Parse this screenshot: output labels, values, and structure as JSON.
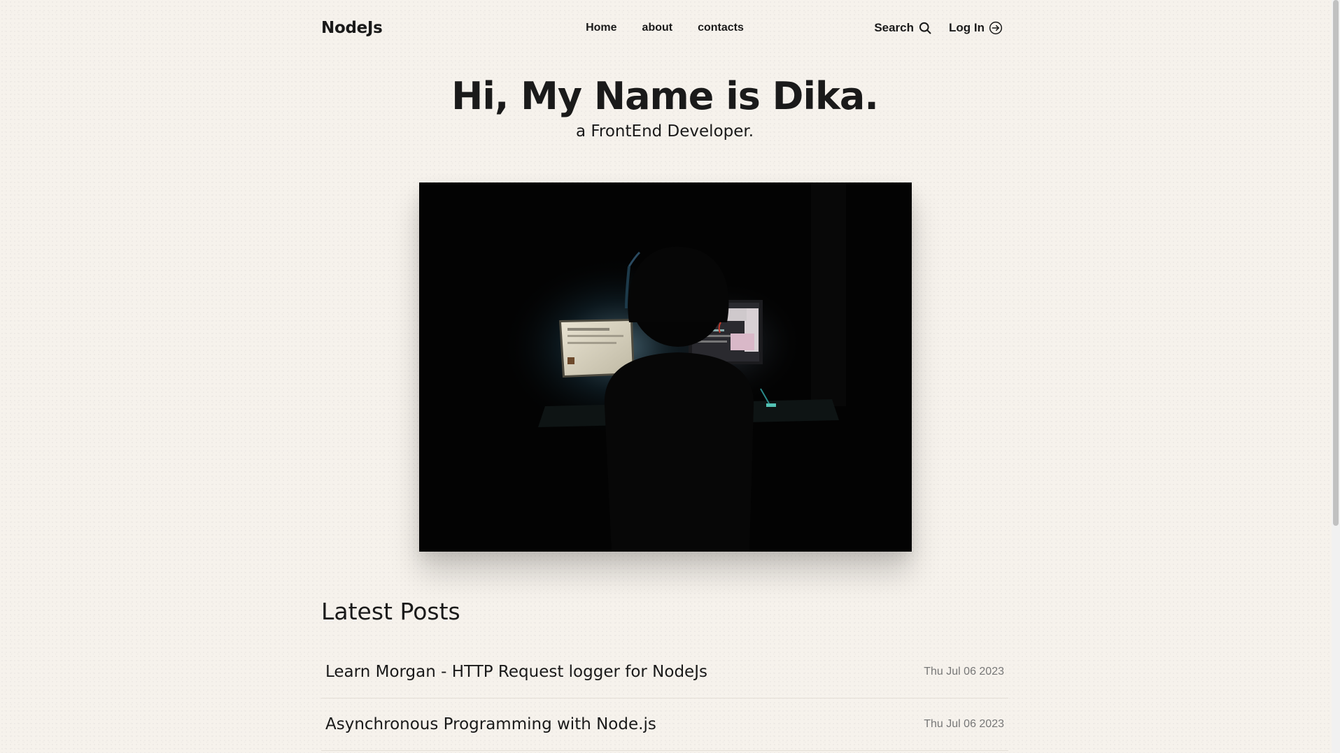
{
  "header": {
    "logo": "NodeJs",
    "nav": [
      {
        "label": "Home"
      },
      {
        "label": "about"
      },
      {
        "label": "contacts"
      }
    ],
    "search_label": "Search",
    "login_label": "Log In"
  },
  "hero": {
    "title": "Hi, My Name is Dika.",
    "subtitle": "a FrontEnd Developer."
  },
  "latest": {
    "heading": "Latest Posts",
    "posts": [
      {
        "title": "Learn Morgan - HTTP Request logger for NodeJs",
        "date": "Thu Jul 06 2023"
      },
      {
        "title": "Asynchronous Programming with Node.js",
        "date": "Thu Jul 06 2023"
      }
    ]
  },
  "icons": {
    "search": "search-icon",
    "login": "login-arrow-icon"
  },
  "colors": {
    "background": "#f6f2ec",
    "text": "#1a1a1a",
    "muted": "#777777"
  }
}
